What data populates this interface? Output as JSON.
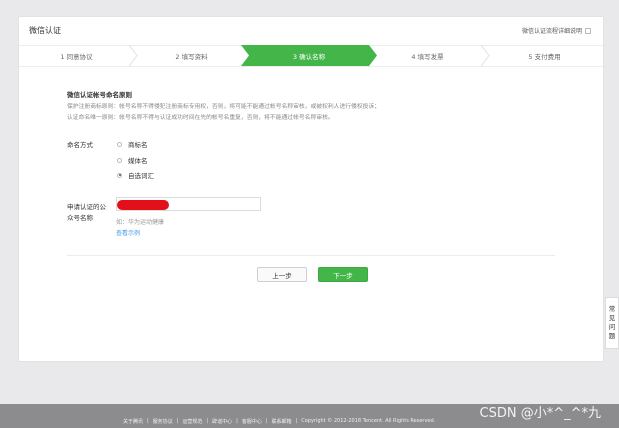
{
  "header": {
    "title": "微信认证",
    "help_link": "微信认证流程详细说明"
  },
  "steps": [
    {
      "label": "1 同意协议",
      "active": false
    },
    {
      "label": "2 填写资料",
      "active": false
    },
    {
      "label": "3 确认名称",
      "active": true
    },
    {
      "label": "4 填写发票",
      "active": false
    },
    {
      "label": "5 支付费用",
      "active": false
    }
  ],
  "naming": {
    "section_title": "微信认证帐号命名原则",
    "rule1": "保护注册商标原则：帐号名称不得侵犯注册商标专用权，否则，将可能不能通过帐号名称审核，或被权利人进行侵权投诉；",
    "rule2": "认证命名唯一原则：帐号名称不得与认证成功时间在先的帐号名重复，否则，将不能通过帐号名称审核。"
  },
  "form": {
    "method_label": "命名方式",
    "options": [
      {
        "label": "商标名",
        "checked": false
      },
      {
        "label": "媒体名",
        "checked": false
      },
      {
        "label": "自选词汇",
        "checked": true
      }
    ],
    "name_label_line1": "申请认证的公",
    "name_label_line2": "众号名称",
    "hint": "如：华为运动健康",
    "example_link": "查看示例"
  },
  "buttons": {
    "prev": "上一步",
    "next": "下一步"
  },
  "side_tab": [
    "常",
    "见",
    "问",
    "题"
  ],
  "footer": {
    "links": [
      "关于腾讯",
      "服务协议",
      "运营规范",
      "辟谣中心",
      "客服中心",
      "联系邮箱",
      "Copyright © 2012-2018 Tencent. All Rights Reserved."
    ],
    "watermark": "CSDN @小*^_^*九"
  },
  "colors": {
    "accent": "#44b549",
    "link": "#459ae9",
    "footer_bg": "#8c8c8f"
  }
}
